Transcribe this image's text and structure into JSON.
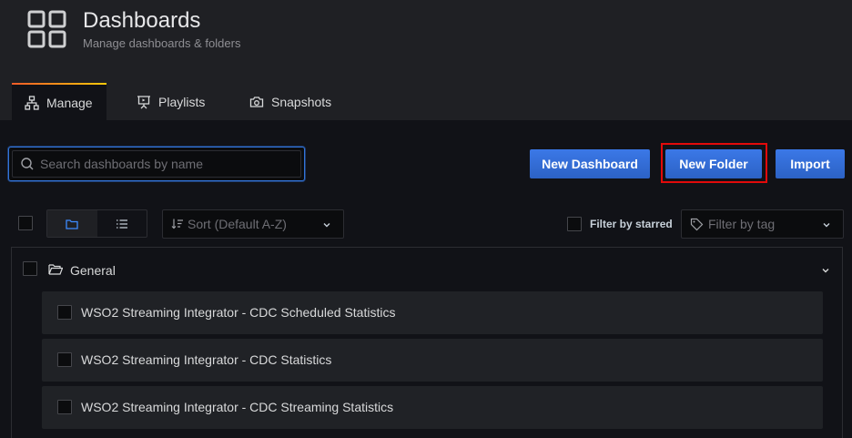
{
  "header": {
    "title": "Dashboards",
    "subtitle": "Manage dashboards & folders",
    "logo_icon": "dashboards-grid-icon"
  },
  "tabs": [
    {
      "label": "Manage",
      "icon": "sitemap-icon",
      "active": true
    },
    {
      "label": "Playlists",
      "icon": "presentation-icon",
      "active": false
    },
    {
      "label": "Snapshots",
      "icon": "camera-icon",
      "active": false
    }
  ],
  "search": {
    "placeholder": "Search dashboards by name",
    "value": ""
  },
  "actions": {
    "new_dashboard": "New Dashboard",
    "new_folder": "New Folder",
    "import": "Import"
  },
  "toolbar": {
    "sort_placeholder": "Sort (Default A-Z)",
    "starred_label": "Filter by starred",
    "tag_placeholder": "Filter by tag",
    "view_mode": "folders"
  },
  "folder": {
    "name": "General",
    "expanded": true
  },
  "dashboards": [
    {
      "title": "WSO2 Streaming Integrator - CDC Scheduled Statistics"
    },
    {
      "title": "WSO2 Streaming Integrator - CDC Statistics"
    },
    {
      "title": "WSO2 Streaming Integrator - CDC Streaming Statistics"
    }
  ],
  "colors": {
    "primary": "#3871dc",
    "highlight": "#e20a0a",
    "tab_accent_start": "#f05a28",
    "tab_accent_end": "#fbca0a"
  }
}
